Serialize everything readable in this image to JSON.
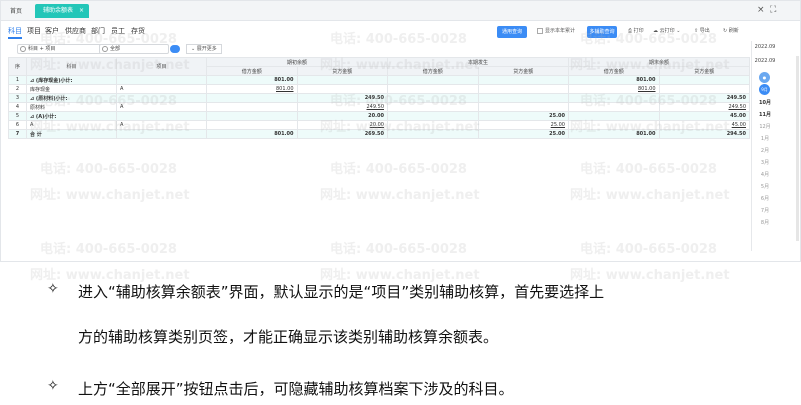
{
  "tabbar": {
    "home": "首页",
    "active_tab": "辅助余额表",
    "close": "×",
    "restore": "×",
    "maximize": "⛶"
  },
  "categories": [
    "科目",
    "项目",
    "客户",
    "供应商",
    "部门",
    "员工",
    "存货"
  ],
  "toolbar": {
    "query_btn": "通用查询",
    "show_label": "显示本年累计",
    "multi_btn": "多辅助查询",
    "print": "打印",
    "cloud_print": "云打印",
    "export": "导出",
    "refresh": "刷新"
  },
  "filters": {
    "subject": "科目 + 项目",
    "scope": "全部",
    "expand": "展开更多"
  },
  "table": {
    "h_seq": "序",
    "h_subject": "科目",
    "h_project": "项目",
    "h_open": "期初余额",
    "h_occur": "本期发生",
    "h_close": "期末余额",
    "h_debit": "借方金额",
    "h_credit": "贷方金额",
    "rows": [
      {
        "seq": "1",
        "subject": "⊿ (库存现金)小计:",
        "project": "",
        "od": "801.00",
        "oc": "",
        "cd": "",
        "cc": "",
        "ed": "801.00",
        "ec": "",
        "teal": true
      },
      {
        "seq": "2",
        "subject": "库存现金",
        "project": "A",
        "od": "801.00",
        "oc": "",
        "cd": "",
        "cc": "",
        "ed": "801.00",
        "ec": "",
        "teal": false
      },
      {
        "seq": "3",
        "subject": "⊿ (原材料)小计:",
        "project": "",
        "od": "",
        "oc": "249.50",
        "cd": "",
        "cc": "",
        "ed": "",
        "ec": "249.50",
        "teal": true
      },
      {
        "seq": "4",
        "subject": "原材料",
        "project": "A",
        "od": "",
        "oc": "249.50",
        "cd": "",
        "cc": "",
        "ed": "",
        "ec": "249.50",
        "teal": false
      },
      {
        "seq": "5",
        "subject": "⊿ (A)小计:",
        "project": "",
        "od": "",
        "oc": "20.00",
        "cd": "",
        "cc": "25.00",
        "ed": "",
        "ec": "45.00",
        "teal": true
      },
      {
        "seq": "6",
        "subject": "A",
        "project": "A",
        "od": "",
        "oc": "20.00",
        "cd": "",
        "cc": "25.00",
        "ed": "",
        "ec": "45.00",
        "teal": false
      },
      {
        "seq": "7",
        "subject": "合 计",
        "project": "",
        "od": "801.00",
        "oc": "269.50",
        "cd": "",
        "cc": "25.00",
        "ed": "801.00",
        "ec": "294.50",
        "teal": true
      }
    ]
  },
  "yearnav": {
    "year1": "2022.09",
    "year2": "2022.09",
    "pill1": "●",
    "pill2": "9月",
    "months": [
      "10月",
      "11月",
      "12月",
      "1月",
      "2月",
      "3月",
      "4月",
      "5月",
      "6月",
      "7月",
      "8月"
    ]
  },
  "watermark": {
    "phone": "电话: 400-665-0028",
    "site": "网址: www.chanjet.net"
  },
  "bullets": [
    {
      "sym": "✧",
      "text": "进入“辅助核算余额表”界面，默认显示的是“项目”类别辅助核算，首先要选择上"
    },
    {
      "sym": "",
      "text": "方的辅助核算类别页签，才能正确显示该类别辅助核算余额表。"
    },
    {
      "sym": "✧",
      "text": "上方“全部展开”按钮点击后，可隐藏辅助核算档案下涉及的科目。"
    }
  ]
}
